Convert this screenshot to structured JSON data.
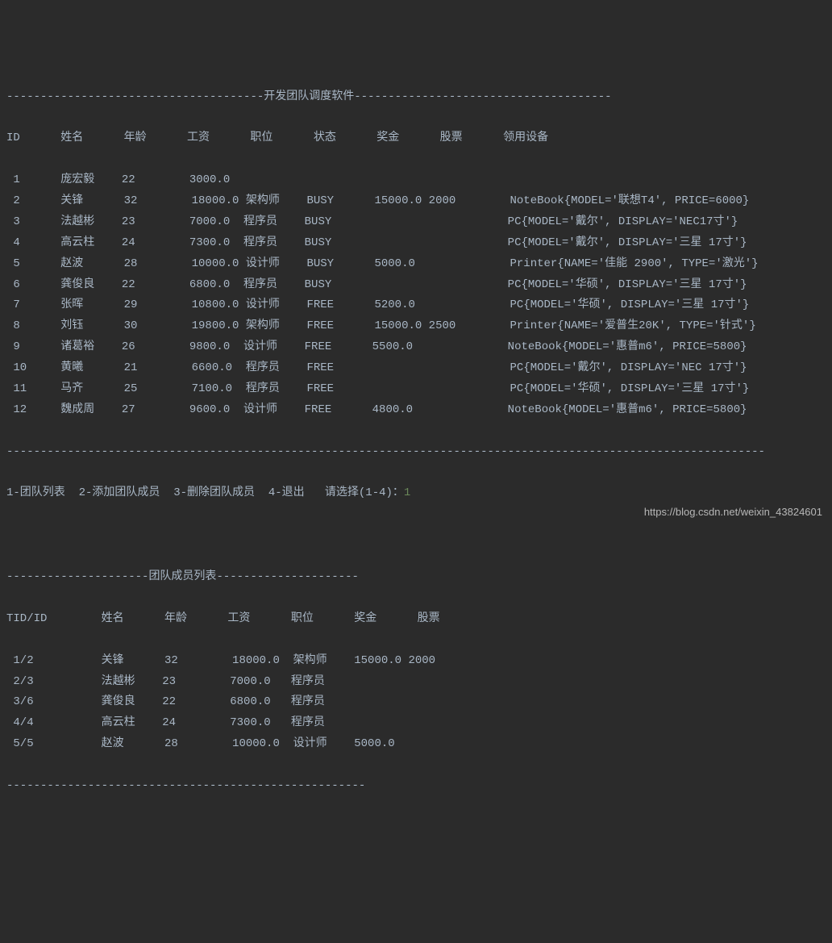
{
  "header": {
    "title": "开发团队调度软件",
    "separator": "--------------------------------------"
  },
  "main_table": {
    "headers": {
      "id": "ID",
      "name": "姓名",
      "age": "年龄",
      "salary": "工资",
      "position": "职位",
      "status": "状态",
      "bonus": "奖金",
      "stock": "股票",
      "equipment": "领用设备"
    },
    "rows": [
      {
        "id": "1",
        "name": "庞宏毅",
        "age": "22",
        "salary": "3000.0",
        "position": "",
        "status": "",
        "bonus": "",
        "stock": "",
        "equipment": ""
      },
      {
        "id": "2",
        "name": "关锋",
        "age": "32",
        "salary": "18000.0",
        "position": "架构师",
        "status": "BUSY",
        "bonus": "15000.0",
        "stock": "2000",
        "equipment": "NoteBook{MODEL='联想T4', PRICE=6000}"
      },
      {
        "id": "3",
        "name": "法越彬",
        "age": "23",
        "salary": "7000.0",
        "position": "程序员",
        "status": "BUSY",
        "bonus": "",
        "stock": "",
        "equipment": "PC{MODEL='戴尔', DISPLAY='NEC17寸'}"
      },
      {
        "id": "4",
        "name": "高云柱",
        "age": "24",
        "salary": "7300.0",
        "position": "程序员",
        "status": "BUSY",
        "bonus": "",
        "stock": "",
        "equipment": "PC{MODEL='戴尔', DISPLAY='三星 17寸'}"
      },
      {
        "id": "5",
        "name": "赵波",
        "age": "28",
        "salary": "10000.0",
        "position": "设计师",
        "status": "BUSY",
        "bonus": "5000.0",
        "stock": "",
        "equipment": "Printer{NAME='佳能 2900', TYPE='激光'}"
      },
      {
        "id": "6",
        "name": "龚俊良",
        "age": "22",
        "salary": "6800.0",
        "position": "程序员",
        "status": "BUSY",
        "bonus": "",
        "stock": "",
        "equipment": "PC{MODEL='华硕', DISPLAY='三星 17寸'}"
      },
      {
        "id": "7",
        "name": "张晖",
        "age": "29",
        "salary": "10800.0",
        "position": "设计师",
        "status": "FREE",
        "bonus": "5200.0",
        "stock": "",
        "equipment": "PC{MODEL='华硕', DISPLAY='三星 17寸'}"
      },
      {
        "id": "8",
        "name": "刘钰",
        "age": "30",
        "salary": "19800.0",
        "position": "架构师",
        "status": "FREE",
        "bonus": "15000.0",
        "stock": "2500",
        "equipment": "Printer{NAME='爱普生20K', TYPE='针式'}"
      },
      {
        "id": "9",
        "name": "诸葛裕",
        "age": "26",
        "salary": "9800.0",
        "position": "设计师",
        "status": "FREE",
        "bonus": "5500.0",
        "stock": "",
        "equipment": "NoteBook{MODEL='惠普m6', PRICE=5800}"
      },
      {
        "id": "10",
        "name": "黄曦",
        "age": "21",
        "salary": "6600.0",
        "position": "程序员",
        "status": "FREE",
        "bonus": "",
        "stock": "",
        "equipment": "PC{MODEL='戴尔', DISPLAY='NEC 17寸'}"
      },
      {
        "id": "11",
        "name": "马齐",
        "age": "25",
        "salary": "7100.0",
        "position": "程序员",
        "status": "FREE",
        "bonus": "",
        "stock": "",
        "equipment": "PC{MODEL='华硕', DISPLAY='三星 17寸'}"
      },
      {
        "id": "12",
        "name": "魏成周",
        "age": "27",
        "salary": "9600.0",
        "position": "设计师",
        "status": "FREE",
        "bonus": "4800.0",
        "stock": "",
        "equipment": "NoteBook{MODEL='惠普m6', PRICE=5800}"
      }
    ]
  },
  "footer_separator": "----------------------------------------------------------------------------------------------------------------",
  "menu": {
    "opt1": "1-团队列表",
    "opt2": "2-添加团队成员",
    "opt3": "3-删除团队成员",
    "opt4": "4-退出",
    "prompt": "请选择(1-4)：",
    "input_value": "1"
  },
  "team_list": {
    "title": "团队成员列表",
    "separator": "---------------------",
    "headers": {
      "tid": "TID/ID",
      "name": "姓名",
      "age": "年龄",
      "salary": "工资",
      "position": "职位",
      "bonus": "奖金",
      "stock": "股票"
    },
    "rows": [
      {
        "tid": "1/2",
        "name": "关锋",
        "age": "32",
        "salary": "18000.0",
        "position": "架构师",
        "bonus": "15000.0",
        "stock": "2000"
      },
      {
        "tid": "2/3",
        "name": "法越彬",
        "age": "23",
        "salary": "7000.0",
        "position": "程序员",
        "bonus": "",
        "stock": ""
      },
      {
        "tid": "3/6",
        "name": "龚俊良",
        "age": "22",
        "salary": "6800.0",
        "position": "程序员",
        "bonus": "",
        "stock": ""
      },
      {
        "tid": "4/4",
        "name": "高云柱",
        "age": "24",
        "salary": "7300.0",
        "position": "程序员",
        "bonus": "",
        "stock": ""
      },
      {
        "tid": "5/5",
        "name": "赵波",
        "age": "28",
        "salary": "10000.0",
        "position": "设计师",
        "bonus": "5000.0",
        "stock": ""
      }
    ]
  },
  "bottom_separator": "-----------------------------------------------------",
  "watermark": "https://blog.csdn.net/weixin_43824601"
}
